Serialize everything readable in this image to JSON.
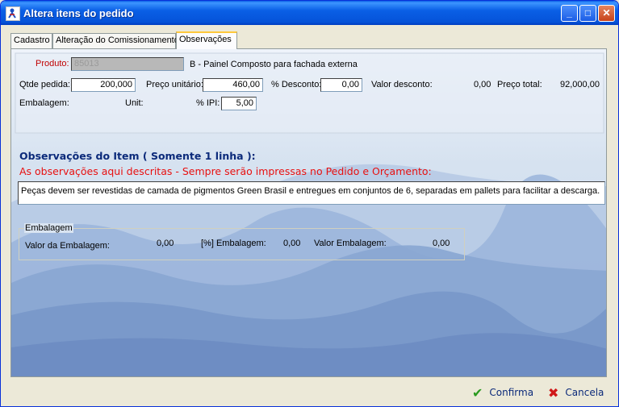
{
  "window": {
    "title": "Altera itens do pedido"
  },
  "tabs": [
    {
      "label": "Cadastro"
    },
    {
      "label": "Alteração do Comissionamento"
    },
    {
      "label": "Observações"
    }
  ],
  "produto": {
    "label": "Produto:",
    "code": "85013",
    "description": "B - Painel Composto para fachada externa"
  },
  "row1": {
    "qtde_label": "Qtde pedida:",
    "qtde_value": "200,000",
    "preco_label": "Preço unitário:",
    "preco_value": "460,00",
    "desconto_label": "% Desconto:",
    "desconto_value": "0,00",
    "valor_desconto_label": "Valor desconto:",
    "valor_desconto_value": "0,00",
    "preco_total_label": "Preço total:",
    "preco_total_value": "92,000,00"
  },
  "row2": {
    "embalagem_label": "Embalagem:",
    "unit_label": "Unit:",
    "ipi_label": "% IPI:",
    "ipi_value": "5,00"
  },
  "observacoes": {
    "title": "Observações do Item ( Somente 1 linha ):",
    "subtitle": "As observações aqui descritas - Sempre serão impressas no Pedido e Orçamento:",
    "value": "Peças devem ser revestidas de camada de pigmentos Green Brasil e entregues em conjuntos de 6, separadas em pallets para facilitar a descarga."
  },
  "embalagem_group": {
    "caption": "Embalagem",
    "valor_label": "Valor da Embalagem:",
    "valor_value": "0,00",
    "pct_label": "[%] Embalagem:",
    "pct_value": "0,00",
    "valor_emb_label": "Valor Embalagem:",
    "valor_emb_value": "0,00"
  },
  "buttons": {
    "confirma": "Confirma",
    "cancela": "Cancela"
  },
  "colors": {
    "title_bar": "#0a5fe6",
    "red_text": "#e81010",
    "blue_text": "#0b2a7a"
  }
}
